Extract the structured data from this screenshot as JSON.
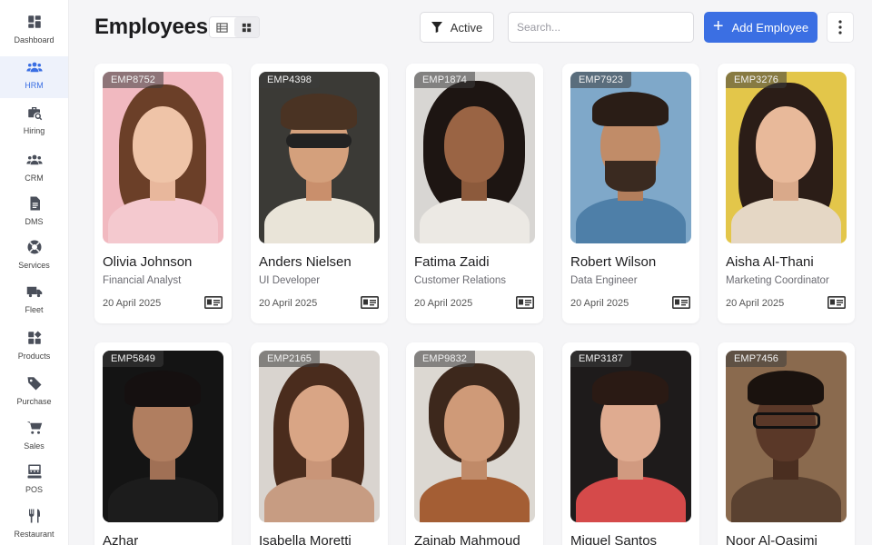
{
  "sidebar": {
    "items": [
      {
        "label": "Dashboard",
        "icon": "dashboard-icon"
      },
      {
        "label": "HRM",
        "icon": "people-icon",
        "active": true
      },
      {
        "label": "Hiring",
        "icon": "briefcase-search-icon"
      },
      {
        "label": "CRM",
        "icon": "group-icon"
      },
      {
        "label": "DMS",
        "icon": "document-icon"
      },
      {
        "label": "Services",
        "icon": "support-icon"
      },
      {
        "label": "Fleet",
        "icon": "truck-icon"
      },
      {
        "label": "Products",
        "icon": "products-icon"
      },
      {
        "label": "Purchase",
        "icon": "tag-icon"
      },
      {
        "label": "Sales",
        "icon": "cart-icon"
      },
      {
        "label": "POS",
        "icon": "pos-terminal-icon"
      },
      {
        "label": "Restaurant",
        "icon": "fork-knife-icon"
      }
    ]
  },
  "header": {
    "title": "Employees",
    "filter_label": "Active",
    "search_placeholder": "Search...",
    "add_label": "Add Employee"
  },
  "accent_color": "#3b6fe3",
  "employees": [
    {
      "id": "EMP8752",
      "name": "Olivia Johnson",
      "role": "Financial Analyst",
      "date": "20 April 2025"
    },
    {
      "id": "EMP4398",
      "name": "Anders Nielsen",
      "role": "UI Developer",
      "date": "20 April 2025"
    },
    {
      "id": "EMP1874",
      "name": "Fatima Zaidi",
      "role": "Customer Relations",
      "date": "20 April 2025"
    },
    {
      "id": "EMP7923",
      "name": "Robert Wilson",
      "role": "Data Engineer",
      "date": "20 April 2025"
    },
    {
      "id": "EMP3276",
      "name": "Aisha Al-Thani",
      "role": "Marketing Coordinator",
      "date": "20 April 2025"
    },
    {
      "id": "EMP5849",
      "name": "Azhar"
    },
    {
      "id": "EMP2165",
      "name": "Isabella Moretti"
    },
    {
      "id": "EMP9832",
      "name": "Zainab Mahmoud"
    },
    {
      "id": "EMP3187",
      "name": "Miguel Santos"
    },
    {
      "id": "EMP7456",
      "name": "Noor Al-Qasimi"
    }
  ]
}
